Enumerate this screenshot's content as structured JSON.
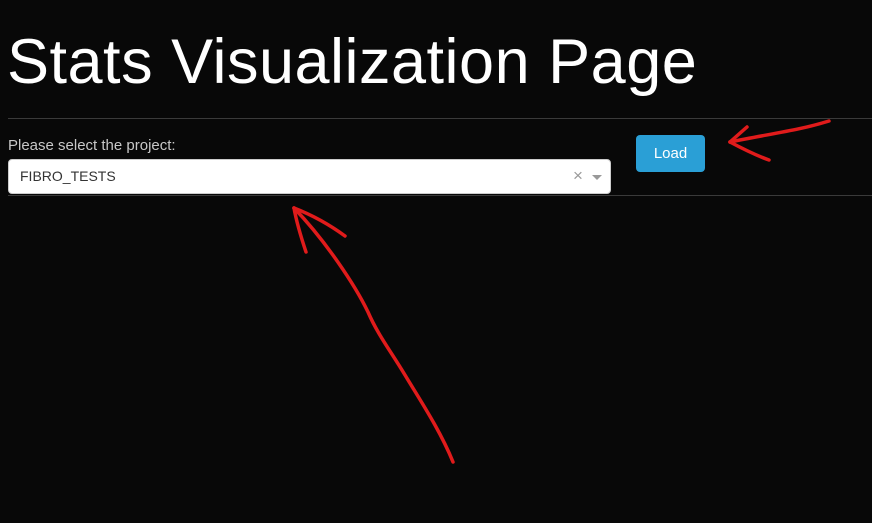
{
  "header": {
    "title": "Stats Visualization Page"
  },
  "project_selector": {
    "label": "Please select the project:",
    "selected_value": "FIBRO_TESTS",
    "clear_glyph": "×"
  },
  "toolbar": {
    "load_label": "Load"
  },
  "colors": {
    "background": "#080808",
    "accent_button": "#2a9fd6",
    "annotation_ink": "#e01b1b"
  },
  "icons": {
    "clear": "close-icon",
    "dropdown": "chevron-down-icon"
  }
}
